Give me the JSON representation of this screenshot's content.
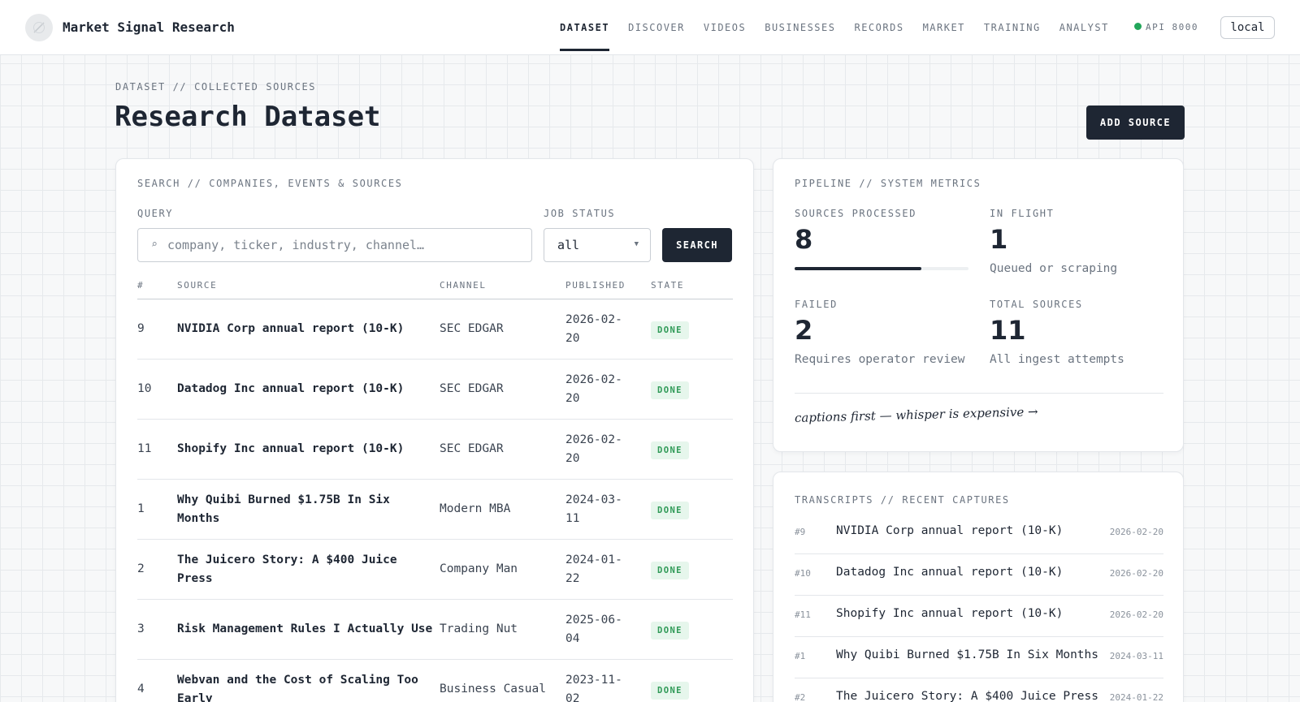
{
  "app": {
    "brand": "Market Signal Research",
    "nav": [
      "DATASET",
      "DISCOVER",
      "VIDEOS",
      "BUSINESSES",
      "RECORDS",
      "MARKET",
      "TRAINING",
      "ANALYST"
    ],
    "active_nav": "DATASET",
    "api_status": "API 8000",
    "env_button": "local"
  },
  "header": {
    "breadcrumb": "DATASET // COLLECTED SOURCES",
    "title": "Research Dataset",
    "add_button": "ADD SOURCE"
  },
  "search": {
    "section_label": "SEARCH // COMPANIES, EVENTS & SOURCES",
    "query_label": "QUERY",
    "query_placeholder": "company, ticker, industry, channel…",
    "query_value": "",
    "status_label": "JOB STATUS",
    "status_value": "all",
    "search_button": "SEARCH"
  },
  "table": {
    "columns": [
      "#",
      "SOURCE",
      "CHANNEL",
      "PUBLISHED",
      "STATE"
    ],
    "rows": [
      {
        "num": "9",
        "source": "NVIDIA Corp annual report (10-K)",
        "channel": "SEC EDGAR",
        "published": "2026-02-20",
        "state": "DONE"
      },
      {
        "num": "10",
        "source": "Datadog Inc annual report (10-K)",
        "channel": "SEC EDGAR",
        "published": "2026-02-20",
        "state": "DONE"
      },
      {
        "num": "11",
        "source": "Shopify Inc annual report (10-K)",
        "channel": "SEC EDGAR",
        "published": "2026-02-20",
        "state": "DONE"
      },
      {
        "num": "1",
        "source": "Why Quibi Burned $1.75B In Six Months",
        "channel": "Modern MBA",
        "published": "2024-03-11",
        "state": "DONE"
      },
      {
        "num": "2",
        "source": "The Juicero Story: A $400 Juice Press",
        "channel": "Company Man",
        "published": "2024-01-22",
        "state": "DONE"
      },
      {
        "num": "3",
        "source": "Risk Management Rules I Actually Use",
        "channel": "Trading Nut",
        "published": "2025-06-04",
        "state": "DONE"
      },
      {
        "num": "4",
        "source": "Webvan and the Cost of Scaling Too Early",
        "channel": "Business Casual",
        "published": "2023-11-02",
        "state": "DONE"
      }
    ]
  },
  "pipeline": {
    "section_label": "PIPELINE // SYSTEM METRICS",
    "sources_processed": {
      "label": "SOURCES PROCESSED",
      "value": "8",
      "progress": 0.73
    },
    "in_flight": {
      "label": "IN FLIGHT",
      "value": "1",
      "sub": "Queued or scraping"
    },
    "failed": {
      "label": "FAILED",
      "value": "2",
      "sub": "Requires operator review"
    },
    "total_sources": {
      "label": "TOTAL SOURCES",
      "value": "11",
      "sub": "All ingest attempts"
    },
    "note": "captions first — whisper is expensive →"
  },
  "transcripts": {
    "section_label": "TRANSCRIPTS // RECENT CAPTURES",
    "items": [
      {
        "id": "#9",
        "title": "NVIDIA Corp annual report (10-K)",
        "date": "2026-02-20"
      },
      {
        "id": "#10",
        "title": "Datadog Inc annual report (10-K)",
        "date": "2026-02-20"
      },
      {
        "id": "#11",
        "title": "Shopify Inc annual report (10-K)",
        "date": "2026-02-20"
      },
      {
        "id": "#1",
        "title": "Why Quibi Burned $1.75B In Six Months",
        "date": "2024-03-11"
      },
      {
        "id": "#2",
        "title": "The Juicero Story: A $400 Juice Press",
        "date": "2024-01-22"
      }
    ]
  },
  "colors": {
    "accent": "#1e2633",
    "status_ok": "#22a65a",
    "badge_bg": "#e6f6ec"
  }
}
